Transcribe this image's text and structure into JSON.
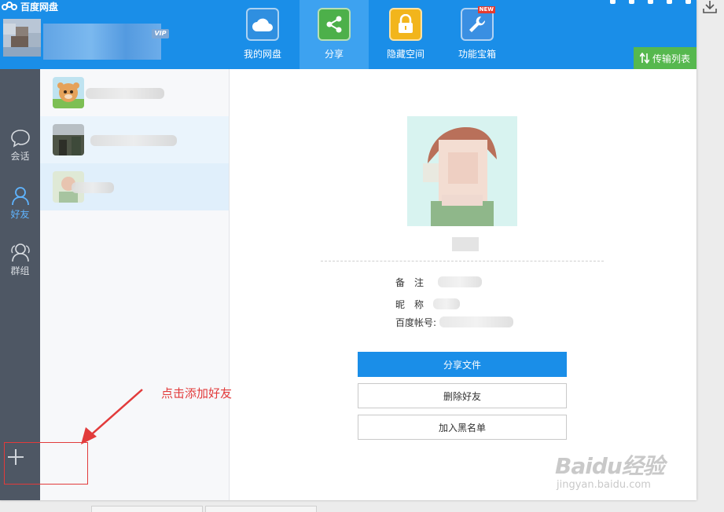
{
  "app": {
    "title": "百度网盘",
    "vip_badge": "VIP"
  },
  "nav": {
    "items": [
      {
        "label": "我的网盘",
        "icon": "cloud-icon",
        "color": "#2f8fe0"
      },
      {
        "label": "分享",
        "icon": "share-icon",
        "color": "#4db04a",
        "active": true
      },
      {
        "label": "隐藏空间",
        "icon": "lock-icon",
        "color": "#f2b51c"
      },
      {
        "label": "功能宝箱",
        "icon": "wrench-icon",
        "color": "#3a8fe2",
        "badge": "NEW"
      }
    ]
  },
  "transfer_list": {
    "label": "传输列表"
  },
  "sidebar": {
    "items": [
      {
        "label": "会话",
        "icon": "chat-bubble-icon"
      },
      {
        "label": "好友",
        "icon": "user-icon",
        "active": true
      },
      {
        "label": "群组",
        "icon": "group-icon"
      }
    ]
  },
  "profile": {
    "fields": [
      {
        "key": "备　注"
      },
      {
        "key": "昵　称"
      },
      {
        "key": "百度帐号:"
      }
    ]
  },
  "actions": {
    "share_files": "分享文件",
    "delete_friend": "删除好友",
    "blacklist": "加入黑名单"
  },
  "annotation": {
    "text": "点击添加好友"
  },
  "watermark": {
    "logo": "Baidu经验",
    "url": "jingyan.baidu.com"
  },
  "colors": {
    "header": "#1a8ee8",
    "sidebar": "#4e5764",
    "accent": "#1a8ee8",
    "transfer": "#56b84e",
    "annotation": "#e23b3b"
  }
}
